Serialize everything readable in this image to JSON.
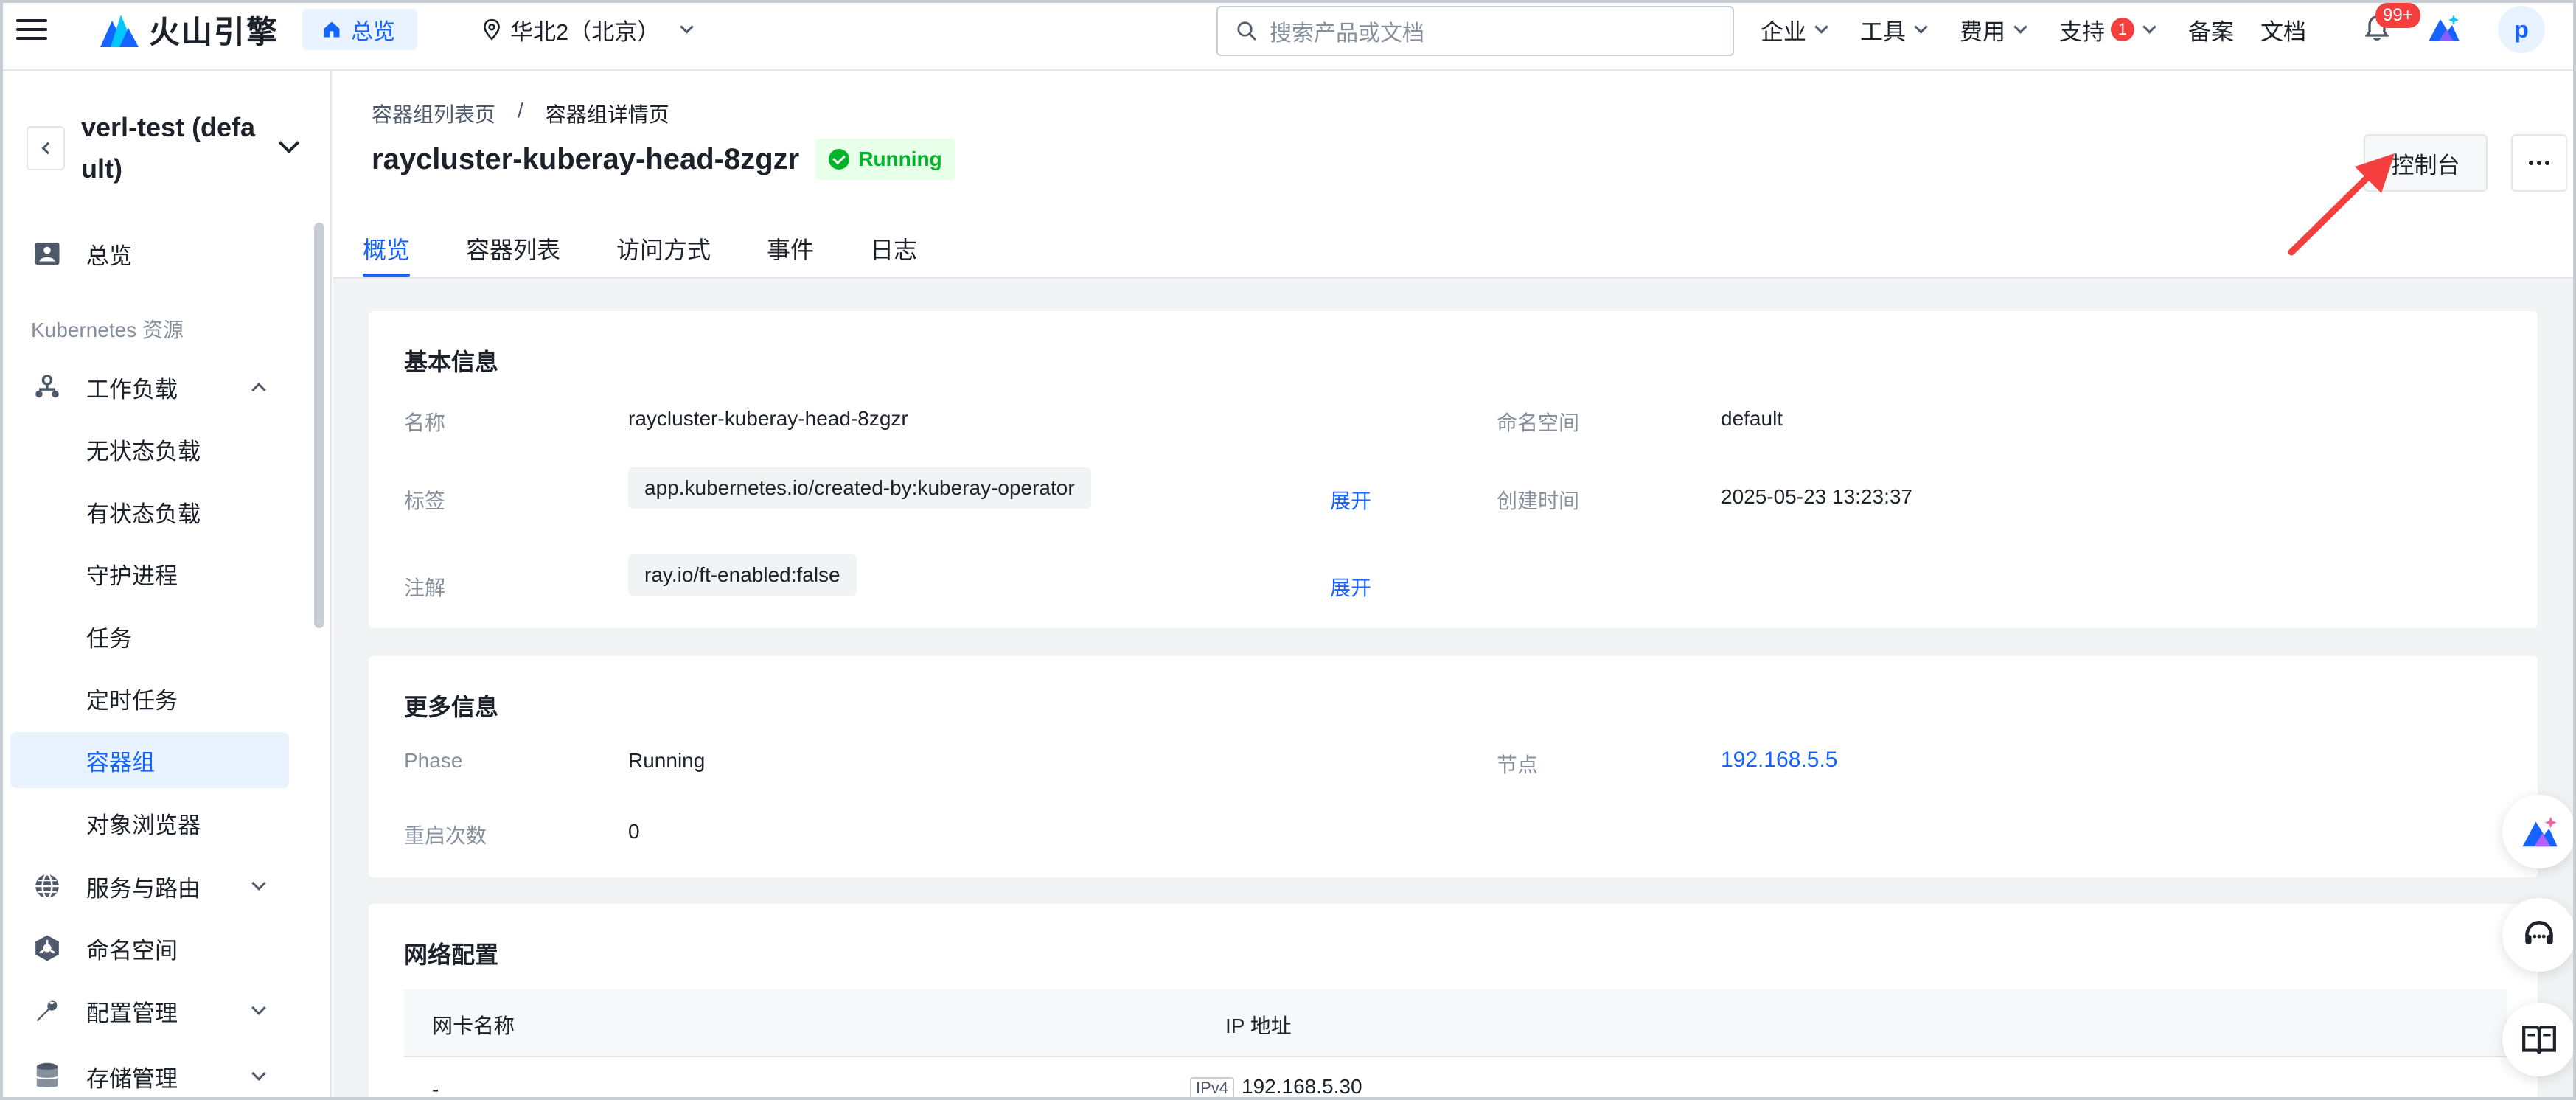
{
  "topbar": {
    "brand": "火山引擎",
    "home_label": "总览",
    "region": "华北2（北京）",
    "search_placeholder": "搜索产品或文档",
    "nav": [
      {
        "label": "企业",
        "has_menu": true
      },
      {
        "label": "工具",
        "has_menu": true
      },
      {
        "label": "费用",
        "has_menu": true
      },
      {
        "label": "支持",
        "has_menu": true,
        "badge": "1"
      },
      {
        "label": "备案",
        "has_menu": false
      },
      {
        "label": "文档",
        "has_menu": false
      }
    ],
    "bell_badge": "99+",
    "avatar_letter": "p"
  },
  "sidebar": {
    "cluster_name": "verl-test (default)",
    "overview": "总览",
    "group_label": "Kubernetes 资源",
    "workload": "工作负载",
    "workload_items": [
      "无状态负载",
      "有状态负载",
      "守护进程",
      "任务",
      "定时任务",
      "容器组",
      "对象浏览器"
    ],
    "active_item": "容器组",
    "service": "服务与路由",
    "namespace": "命名空间",
    "config": "配置管理",
    "storage": "存储管理"
  },
  "page": {
    "breadcrumb": [
      "容器组列表页",
      "/",
      "容器组详情页"
    ],
    "title": "raycluster-kuberay-head-8zgzr",
    "status": "Running",
    "console_button": "控制台",
    "tabs": [
      "概览",
      "容器列表",
      "访问方式",
      "事件",
      "日志"
    ],
    "active_tab": "概览"
  },
  "basic_info": {
    "title": "基本信息",
    "name_label": "名称",
    "name_value": "raycluster-kuberay-head-8zgzr",
    "namespace_label": "命名空间",
    "namespace_value": "default",
    "labels_label": "标签",
    "labels_value": "app.kubernetes.io/created-by:kuberay-operator",
    "expand_label": "展开",
    "created_label": "创建时间",
    "created_value": "2025-05-23 13:23:37",
    "annotations_label": "注解",
    "annotations_value": "ray.io/ft-enabled:false"
  },
  "more_info": {
    "title": "更多信息",
    "phase_label": "Phase",
    "phase_value": "Running",
    "node_label": "节点",
    "node_value": "192.168.5.5",
    "restart_label": "重启次数",
    "restart_value": "0"
  },
  "network": {
    "title": "网络配置",
    "columns": [
      "网卡名称",
      "IP 地址"
    ],
    "rows": [
      {
        "nic": "-",
        "ip_type": "IPv4",
        "ip": "192.168.5.30"
      }
    ]
  },
  "colors": {
    "accent": "#1664ff",
    "success": "#00b42a",
    "danger": "#f53f3f",
    "page_bg": "#f2f3f5"
  }
}
